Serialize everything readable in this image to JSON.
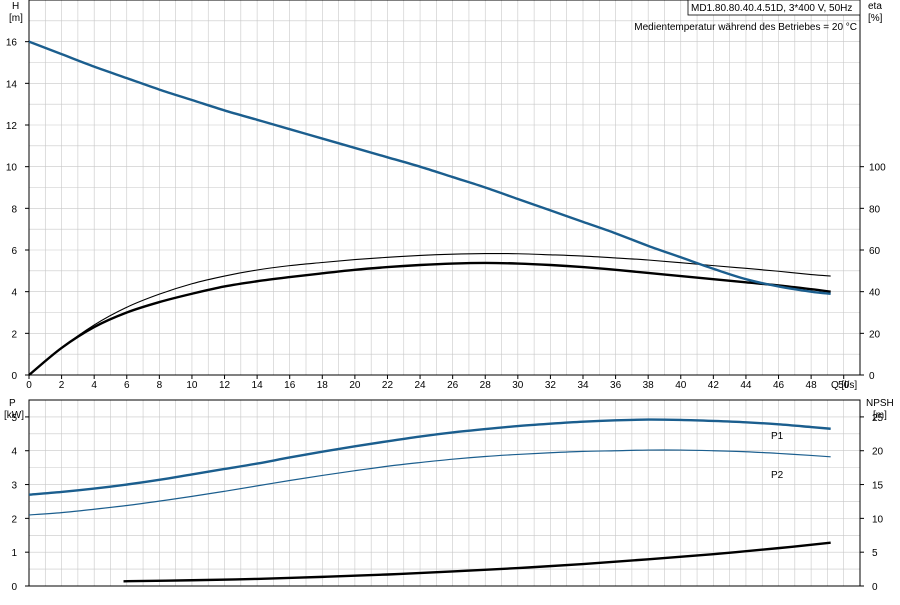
{
  "colors": {
    "grid": "#c8c8c8",
    "axis": "#000000",
    "head_curve": "#1b5e8e",
    "p1_curve": "#1b5e8e",
    "p2_curve": "#1b5e8e",
    "eta_curve": "#000000",
    "npsh_curve": "#000000",
    "text": "#000000"
  },
  "chart_data": [
    {
      "type": "line",
      "panel": "upper",
      "info_box": "MD1.80.80.40.4.51D, 3*400 V, 50Hz",
      "subtitle": "Medientemperatur während des Betriebes = 20 °C",
      "xlabel": "Q [l/s]",
      "ylabel": [
        "H",
        "[m]"
      ],
      "y2label": [
        "eta",
        "[%]"
      ],
      "xlim": [
        0,
        51
      ],
      "ylim": [
        0,
        18
      ],
      "y2lim": [
        0,
        180
      ],
      "xticks": [
        0,
        2,
        4,
        6,
        8,
        10,
        12,
        14,
        16,
        18,
        20,
        22,
        24,
        26,
        28,
        30,
        32,
        34,
        36,
        38,
        40,
        42,
        44,
        46,
        48,
        50
      ],
      "yticks": [
        0,
        2,
        4,
        6,
        8,
        10,
        12,
        14,
        16
      ],
      "y2ticks": [
        0,
        20,
        40,
        60,
        80,
        100
      ],
      "grid": true,
      "series": [
        {
          "axis": "left",
          "x": [
            0,
            2,
            4,
            6,
            8,
            10,
            12,
            14,
            16,
            18,
            20,
            22,
            24,
            26,
            28,
            30,
            32,
            34,
            36,
            38,
            40,
            42,
            44,
            46,
            48,
            49.2
          ],
          "values": [
            16.0,
            15.4,
            14.8,
            14.25,
            13.7,
            13.2,
            12.7,
            12.25,
            11.8,
            11.35,
            10.9,
            10.45,
            10.0,
            9.5,
            9.0,
            8.45,
            7.9,
            7.35,
            6.8,
            6.2,
            5.65,
            5.1,
            4.6,
            4.25,
            4.0,
            3.9
          ]
        },
        {
          "axis": "right",
          "x": [
            0,
            2,
            4,
            6,
            8,
            10,
            12,
            14,
            16,
            18,
            20,
            22,
            24,
            26,
            28,
            30,
            32,
            34,
            36,
            38,
            40,
            42,
            44,
            46,
            48,
            49.2
          ],
          "values": [
            0,
            13,
            24,
            32.5,
            38.8,
            43.8,
            47.5,
            50.4,
            52.5,
            54.0,
            55.4,
            56.5,
            57.4,
            58.0,
            58.3,
            58.2,
            57.7,
            57.1,
            56.2,
            55.2,
            53.9,
            52.5,
            51.2,
            49.8,
            48.2,
            47.5
          ]
        },
        {
          "axis": "left",
          "x": [
            0,
            2,
            4,
            6,
            8,
            10,
            12,
            14,
            16,
            18,
            20,
            22,
            24,
            26,
            28,
            30,
            32,
            34,
            36,
            38,
            40,
            42,
            44,
            46,
            48,
            49.2
          ],
          "values": [
            0,
            1.3,
            2.3,
            3.0,
            3.5,
            3.9,
            4.25,
            4.5,
            4.7,
            4.88,
            5.05,
            5.18,
            5.28,
            5.35,
            5.38,
            5.35,
            5.28,
            5.18,
            5.05,
            4.9,
            4.75,
            4.6,
            4.45,
            4.3,
            4.12,
            4.0
          ]
        }
      ]
    },
    {
      "type": "line",
      "panel": "lower",
      "ylabel": [
        "P",
        "[kW]"
      ],
      "y2label": [
        "NPSH",
        "[m]"
      ],
      "xlim": [
        0,
        51
      ],
      "ylim": [
        0,
        5.5
      ],
      "y2lim": [
        0,
        27.5
      ],
      "yticks": [
        0,
        1,
        2,
        3,
        4,
        5
      ],
      "y2ticks": [
        0,
        5,
        10,
        15,
        20,
        25
      ],
      "grid": true,
      "series": [
        {
          "name": "P1",
          "axis": "left",
          "x": [
            0,
            2,
            4,
            6,
            8,
            10,
            12,
            14,
            16,
            18,
            20,
            22,
            24,
            26,
            28,
            30,
            32,
            34,
            36,
            38,
            40,
            42,
            44,
            46,
            48,
            49.2
          ],
          "values": [
            2.7,
            2.78,
            2.88,
            3.0,
            3.14,
            3.3,
            3.46,
            3.62,
            3.8,
            3.97,
            4.13,
            4.28,
            4.42,
            4.54,
            4.64,
            4.73,
            4.8,
            4.86,
            4.9,
            4.92,
            4.91,
            4.88,
            4.84,
            4.78,
            4.7,
            4.65
          ]
        },
        {
          "name": "P2",
          "axis": "left",
          "x": [
            0,
            2,
            4,
            6,
            8,
            10,
            12,
            14,
            16,
            18,
            20,
            22,
            24,
            26,
            28,
            30,
            32,
            34,
            36,
            38,
            40,
            42,
            44,
            46,
            48,
            49.2
          ],
          "values": [
            2.1,
            2.17,
            2.27,
            2.38,
            2.51,
            2.65,
            2.8,
            2.96,
            3.12,
            3.27,
            3.41,
            3.54,
            3.65,
            3.75,
            3.83,
            3.89,
            3.94,
            3.98,
            4.0,
            4.02,
            4.02,
            4.0,
            3.97,
            3.92,
            3.86,
            3.82
          ]
        },
        {
          "axis": "right",
          "x": [
            5.8,
            10,
            14,
            18,
            22,
            26,
            30,
            34,
            38,
            42,
            46,
            49.2
          ],
          "values": [
            0.7,
            0.85,
            1.05,
            1.35,
            1.7,
            2.15,
            2.65,
            3.25,
            3.95,
            4.7,
            5.6,
            6.4
          ]
        }
      ]
    }
  ]
}
